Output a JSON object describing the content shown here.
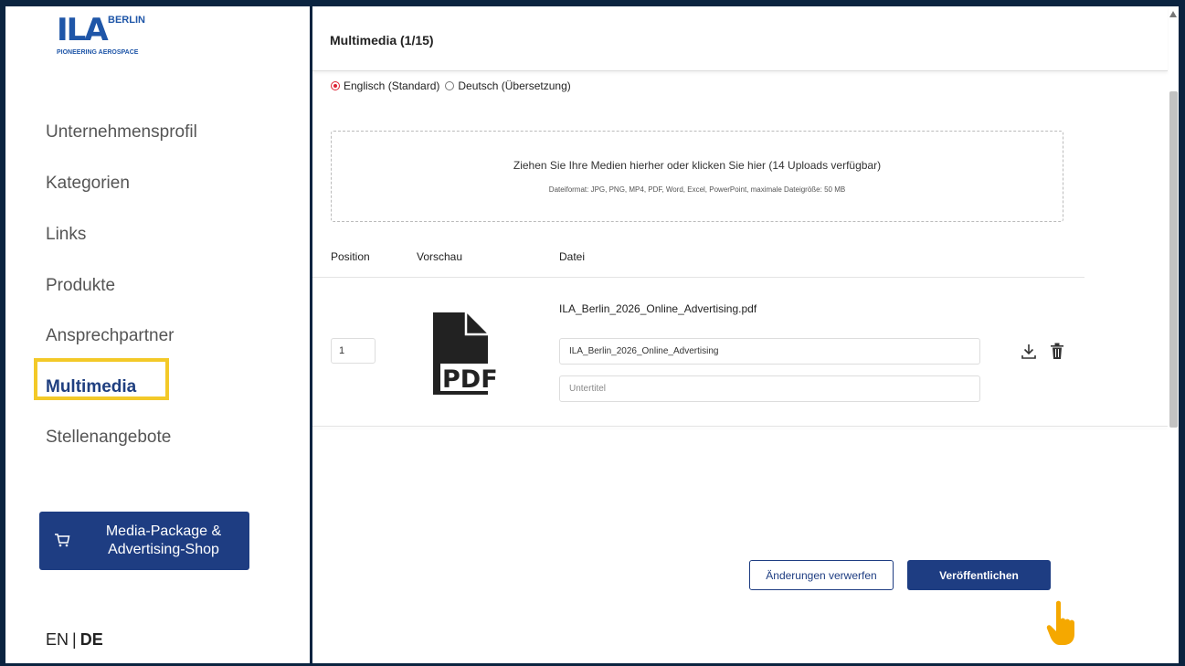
{
  "logo": {
    "main": "ILA",
    "city": "BERLIN",
    "tagline": "PIONEERING AEROSPACE"
  },
  "sidebar": {
    "items": [
      {
        "label": "Unternehmensprofil"
      },
      {
        "label": "Kategorien"
      },
      {
        "label": "Links"
      },
      {
        "label": "Produkte"
      },
      {
        "label": "Ansprechpartner"
      },
      {
        "label": "Multimedia",
        "active": true
      },
      {
        "label": "Stellenangebote"
      }
    ],
    "shop_button": {
      "label_line1": "Media-Package &",
      "label_line2": "Advertising-Shop",
      "icon": "cart-icon"
    },
    "language": {
      "en": "EN",
      "separator": "|",
      "de": "DE",
      "current": "DE"
    }
  },
  "main": {
    "title": "Multimedia (1/15)",
    "languages": [
      {
        "label": "Englisch (Standard)",
        "selected": true
      },
      {
        "label": "Deutsch (Übersetzung)",
        "selected": false
      }
    ],
    "dropzone": {
      "main_text": "Ziehen Sie Ihre Medien hierher oder klicken Sie hier (14 Uploads verfügbar)",
      "sub_text": "Dateiformat: JPG, PNG, MP4, PDF, Word, Excel, PowerPoint, maximale Dateigröße: 50 MB"
    },
    "table": {
      "headers": {
        "position": "Position",
        "preview": "Vorschau",
        "file": "Datei"
      },
      "rows": [
        {
          "position": "1",
          "preview_icon": "pdf-file-icon",
          "preview_label": "PDF",
          "filename": "ILA_Berlin_2026_Online_Advertising.pdf",
          "title_value": "ILA_Berlin_2026_Online_Advertising",
          "subtitle_placeholder": "Untertitel"
        }
      ]
    },
    "buttons": {
      "discard": "Änderungen verwerfen",
      "publish": "Veröffentlichen"
    }
  },
  "colors": {
    "brand": "#1e3d82",
    "frame": "#0b2440",
    "highlight": "#f3c928",
    "radio_selected": "#dd2233",
    "pointer": "#f5a800"
  }
}
